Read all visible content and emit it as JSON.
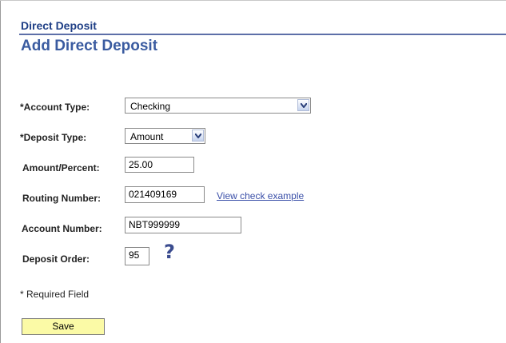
{
  "header": {
    "section_title": "Direct Deposit",
    "page_title": "Add Direct Deposit"
  },
  "form": {
    "account_type": {
      "label": "*Account Type:",
      "value": "Checking"
    },
    "deposit_type": {
      "label": "*Deposit Type:",
      "value": "Amount"
    },
    "amount_percent": {
      "label": "Amount/Percent:",
      "value": "25.00"
    },
    "routing_number": {
      "label": "Routing Number:",
      "value": "021409169",
      "link": "View check example"
    },
    "account_number": {
      "label": "Account Number:",
      "value": "NBT999999"
    },
    "deposit_order": {
      "label": "Deposit Order:",
      "value": "95"
    },
    "required_note": "* Required Field",
    "save_label": "Save"
  },
  "icons": {
    "help": "question-mark-icon",
    "dropdown": "chevron-down-icon"
  },
  "colors": {
    "section_title": "#1f3f86",
    "page_title": "#3a5ba0",
    "save_button_bg": "#fbfaa6",
    "link": "#3a4fa8"
  }
}
